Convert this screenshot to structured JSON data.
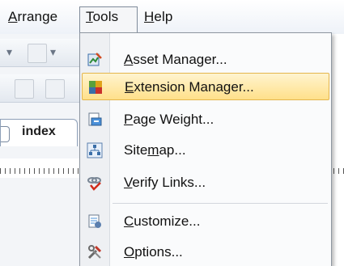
{
  "menubar": {
    "items": [
      {
        "label": "Arrange",
        "underline": "A",
        "rest": "rrange"
      },
      {
        "label": "Tools",
        "underline": "T",
        "rest": "ools"
      },
      {
        "label": "Help",
        "underline": "H",
        "rest": "elp"
      }
    ]
  },
  "tab": {
    "label": "index"
  },
  "tools_menu": {
    "items": [
      {
        "icon": "asset-manager-icon",
        "pre": "",
        "u": "A",
        "post": "sset Manager..."
      },
      {
        "icon": "extension-manager-icon",
        "pre": "",
        "u": "E",
        "post": "xtension Manager...",
        "highlighted": true
      },
      {
        "icon": "page-weight-icon",
        "pre": "",
        "u": "P",
        "post": "age Weight..."
      },
      {
        "icon": "sitemap-icon",
        "pre": "Site",
        "u": "m",
        "post": "ap..."
      },
      {
        "icon": "verify-links-icon",
        "pre": "",
        "u": "V",
        "post": "erify Links..."
      },
      {
        "icon": "customize-icon",
        "pre": "",
        "u": "C",
        "post": "ustomize..."
      },
      {
        "icon": "options-icon",
        "pre": "",
        "u": "O",
        "post": "ptions..."
      }
    ]
  },
  "colors": {
    "highlight_top": "#fff4cf",
    "highlight_bottom": "#ffe08a",
    "highlight_border": "#e4b54b"
  }
}
